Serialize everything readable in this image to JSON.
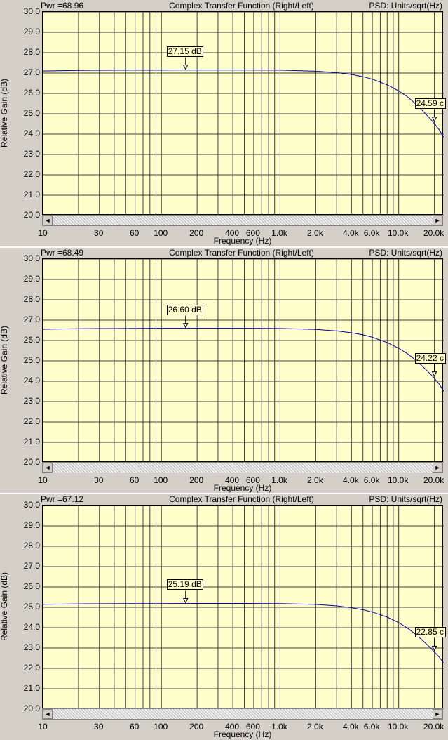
{
  "chart_data": [
    {
      "type": "line",
      "title": "Complex Transfer Function (Right/Left)",
      "pwr": "Pwr =68.96",
      "psd": "PSD: Units/sqrt(Hz)",
      "xlabel": "Frequency (Hz)",
      "ylabel": "Relative Gain (dB)",
      "xscale": "log",
      "xlim": [
        10,
        24000
      ],
      "ylim": [
        20.0,
        30.0
      ],
      "yticks": [
        "20.0",
        "21.0",
        "22.0",
        "23.0",
        "24.0",
        "25.0",
        "26.0",
        "27.0",
        "28.0",
        "29.0",
        "30.0"
      ],
      "xticks": [
        {
          "v": 10,
          "label": "10"
        },
        {
          "v": 30,
          "label": "30"
        },
        {
          "v": 60,
          "label": "60"
        },
        {
          "v": 100,
          "label": "100"
        },
        {
          "v": 200,
          "label": "200"
        },
        {
          "v": 400,
          "label": "400"
        },
        {
          "v": 600,
          "label": "600"
        },
        {
          "v": 1000,
          "label": "1.0k"
        },
        {
          "v": 2000,
          "label": "2.0k"
        },
        {
          "v": 4000,
          "label": "4.0k"
        },
        {
          "v": 6000,
          "label": "6.0k"
        },
        {
          "v": 10000,
          "label": "10.0k"
        },
        {
          "v": 20000,
          "label": "20.0k"
        }
      ],
      "grid": true,
      "color": "#0000a0",
      "series": [
        {
          "x": [
            10,
            20,
            50,
            100,
            200,
            500,
            1000,
            2000,
            3000,
            4000,
            5000,
            6000,
            8000,
            10000,
            12000,
            14000,
            16000,
            18000,
            20000,
            22000,
            24000
          ],
          "values": [
            27.1,
            27.13,
            27.14,
            27.14,
            27.15,
            27.15,
            27.14,
            27.09,
            27.02,
            26.93,
            26.82,
            26.7,
            26.42,
            26.12,
            25.81,
            25.47,
            25.13,
            24.82,
            24.52,
            24.2,
            23.85
          ]
        }
      ],
      "markers": [
        {
          "x": 160,
          "label": "27.15 dB",
          "arrow_y": 27.15
        },
        {
          "x": 20000,
          "label": "24.59 c",
          "arrow_y": 24.59
        }
      ]
    },
    {
      "type": "line",
      "title": "Complex Transfer Function (Right/Left)",
      "pwr": "Pwr =68.49",
      "psd": "PSD: Units/sqrt(Hz)",
      "xlabel": "Frequency (Hz)",
      "ylabel": "Relative Gain (dB)",
      "xscale": "log",
      "xlim": [
        10,
        24000
      ],
      "ylim": [
        20.0,
        30.0
      ],
      "yticks": [
        "20.0",
        "21.0",
        "22.0",
        "23.0",
        "24.0",
        "25.0",
        "26.0",
        "27.0",
        "28.0",
        "29.0",
        "30.0"
      ],
      "xticks": [
        {
          "v": 10,
          "label": "10"
        },
        {
          "v": 30,
          "label": "30"
        },
        {
          "v": 60,
          "label": "60"
        },
        {
          "v": 100,
          "label": "100"
        },
        {
          "v": 200,
          "label": "200"
        },
        {
          "v": 400,
          "label": "400"
        },
        {
          "v": 600,
          "label": "600"
        },
        {
          "v": 1000,
          "label": "1.0k"
        },
        {
          "v": 2000,
          "label": "2.0k"
        },
        {
          "v": 4000,
          "label": "4.0k"
        },
        {
          "v": 6000,
          "label": "6.0k"
        },
        {
          "v": 10000,
          "label": "10.0k"
        },
        {
          "v": 20000,
          "label": "20.0k"
        }
      ],
      "grid": true,
      "color": "#0000a0",
      "series": [
        {
          "x": [
            10,
            20,
            50,
            100,
            200,
            500,
            1000,
            2000,
            3000,
            4000,
            5000,
            6000,
            8000,
            10000,
            12000,
            14000,
            16000,
            18000,
            20000,
            22000,
            24000
          ],
          "values": [
            26.55,
            26.58,
            26.59,
            26.6,
            26.6,
            26.6,
            26.59,
            26.54,
            26.47,
            26.38,
            26.28,
            26.16,
            25.9,
            25.62,
            25.33,
            25.02,
            24.71,
            24.42,
            24.15,
            23.85,
            23.5
          ]
        }
      ],
      "markers": [
        {
          "x": 160,
          "label": "26.60 dB",
          "arrow_y": 26.6
        },
        {
          "x": 20000,
          "label": "24.22 c",
          "arrow_y": 24.22
        }
      ]
    },
    {
      "type": "line",
      "title": "Complex Transfer Function (Right/Left)",
      "pwr": "Pwr =67.12",
      "psd": "PSD: Units/sqrt(Hz)",
      "xlabel": "Frequency (Hz)",
      "ylabel": "Relative Gain (dB)",
      "xscale": "log",
      "xlim": [
        10,
        24000
      ],
      "ylim": [
        20.0,
        30.0
      ],
      "yticks": [
        "20.0",
        "21.0",
        "22.0",
        "23.0",
        "24.0",
        "25.0",
        "26.0",
        "27.0",
        "28.0",
        "29.0",
        "30.0"
      ],
      "xticks": [
        {
          "v": 10,
          "label": "10"
        },
        {
          "v": 30,
          "label": "30"
        },
        {
          "v": 60,
          "label": "60"
        },
        {
          "v": 100,
          "label": "100"
        },
        {
          "v": 200,
          "label": "200"
        },
        {
          "v": 400,
          "label": "400"
        },
        {
          "v": 600,
          "label": "600"
        },
        {
          "v": 1000,
          "label": "1.0k"
        },
        {
          "v": 2000,
          "label": "2.0k"
        },
        {
          "v": 4000,
          "label": "4.0k"
        },
        {
          "v": 6000,
          "label": "6.0k"
        },
        {
          "v": 10000,
          "label": "10.0k"
        },
        {
          "v": 20000,
          "label": "20.0k"
        }
      ],
      "grid": true,
      "color": "#0000a0",
      "series": [
        {
          "x": [
            10,
            20,
            50,
            100,
            200,
            500,
            1000,
            2000,
            3000,
            4000,
            5000,
            6000,
            8000,
            10000,
            12000,
            14000,
            16000,
            18000,
            20000,
            22000,
            24000
          ],
          "values": [
            25.15,
            25.17,
            25.18,
            25.18,
            25.19,
            25.19,
            25.18,
            25.14,
            25.07,
            24.98,
            24.88,
            24.77,
            24.52,
            24.25,
            23.96,
            23.66,
            23.36,
            23.08,
            22.8,
            22.55,
            22.25
          ]
        }
      ],
      "markers": [
        {
          "x": 160,
          "label": "25.19 dB",
          "arrow_y": 25.19
        },
        {
          "x": 20000,
          "label": "22.85 c",
          "arrow_y": 22.85
        }
      ]
    }
  ],
  "scroll": {
    "left_arrow": "◄",
    "right_arrow": "►"
  }
}
